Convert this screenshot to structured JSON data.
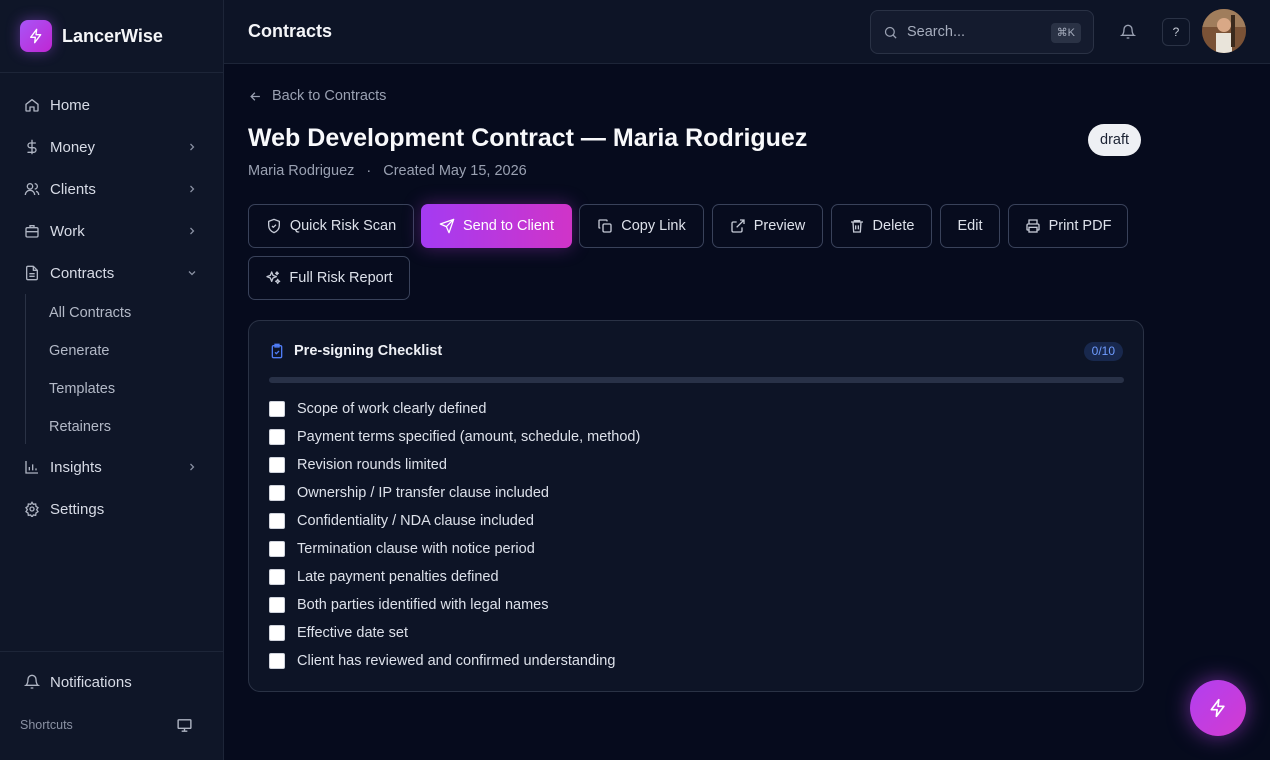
{
  "brand": {
    "name": "LancerWise"
  },
  "sidebar": {
    "items": [
      {
        "label": "Home"
      },
      {
        "label": "Money"
      },
      {
        "label": "Clients"
      },
      {
        "label": "Work"
      },
      {
        "label": "Contracts"
      },
      {
        "label": "Insights"
      },
      {
        "label": "Settings"
      }
    ],
    "contracts_sub": [
      "All Contracts",
      "Generate",
      "Templates",
      "Retainers"
    ],
    "notifications": "Notifications",
    "shortcuts": "Shortcuts"
  },
  "header": {
    "title": "Contracts",
    "search_placeholder": "Search...",
    "search_shortcut": "⌘K",
    "help": "?"
  },
  "page": {
    "back": "Back to Contracts",
    "title": "Web Development Contract — Maria Rodriguez",
    "status": "draft",
    "client": "Maria Rodriguez",
    "separator": "·",
    "created": "Created May 15, 2026"
  },
  "actions": {
    "quick_risk_scan": "Quick Risk Scan",
    "send_to_client": "Send to Client",
    "copy_link": "Copy Link",
    "preview": "Preview",
    "delete": "Delete",
    "edit": "Edit",
    "print_pdf": "Print PDF",
    "full_risk_report": "Full Risk Report"
  },
  "checklist": {
    "title": "Pre-signing Checklist",
    "count": "0/10",
    "progress": 0,
    "items": [
      "Scope of work clearly defined",
      "Payment terms specified (amount, schedule, method)",
      "Revision rounds limited",
      "Ownership / IP transfer clause included",
      "Confidentiality / NDA clause included",
      "Termination clause with notice period",
      "Late payment penalties defined",
      "Both parties identified with legal names",
      "Effective date set",
      "Client has reviewed and confirmed understanding"
    ]
  },
  "colors": {
    "accent": "#a855f7",
    "checklist_blue": "#4f7cf5",
    "background": "#060b1d"
  }
}
